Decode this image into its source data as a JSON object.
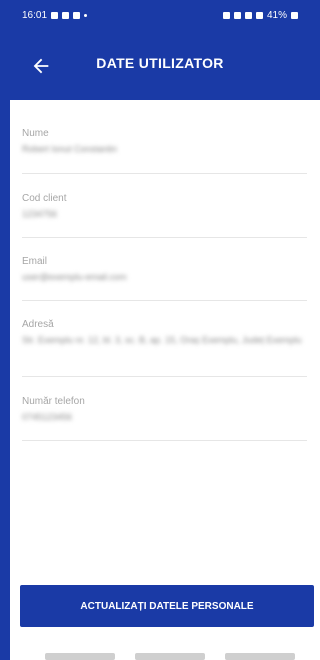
{
  "status_bar": {
    "time": "16:01",
    "battery": "41%"
  },
  "header": {
    "title": "DATE UTILIZATOR",
    "back_icon": "arrow-left-icon"
  },
  "fields": [
    {
      "label": "Nume",
      "value": "Robert Ionut Constantin"
    },
    {
      "label": "Cod client",
      "value": "1234756"
    },
    {
      "label": "Email",
      "value": "user@exemplu-email.com"
    },
    {
      "label": "Adresă",
      "value": "Str. Exemplu nr. 12, bl. 3, sc. B, ap. 15, Oraș Exemplu, Județ Exemplu"
    },
    {
      "label": "Număr telefon",
      "value": "0745123456"
    }
  ],
  "actions": {
    "update_label": "ACTUALIZAȚI DATELE PERSONALE"
  },
  "colors": {
    "brand": "#1a3aa6",
    "background": "#ffffff"
  }
}
